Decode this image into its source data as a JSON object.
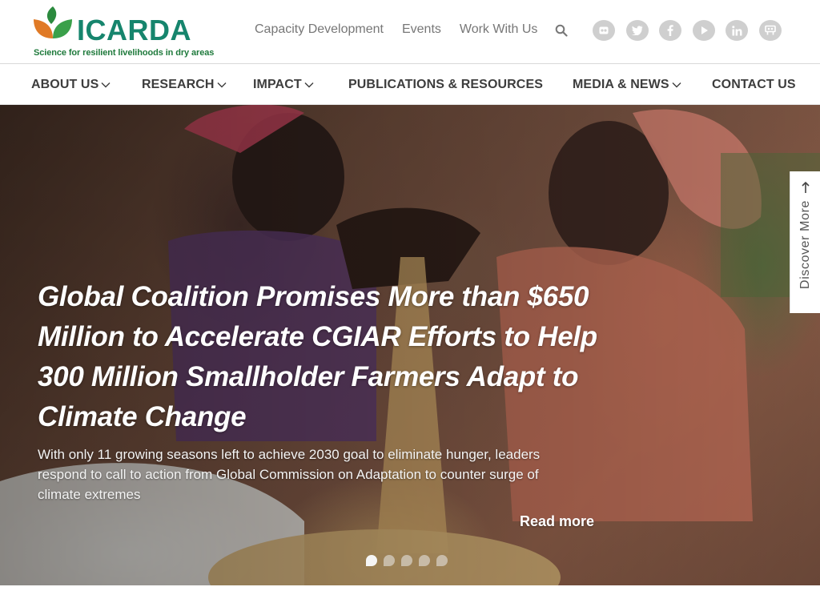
{
  "brand": {
    "name": "ICARDA",
    "tagline": "Science for resilient livelihoods in dry areas",
    "colors": {
      "green": "#16856d",
      "leaf_orange": "#e07a26",
      "leaf_green": "#2b8a3e"
    }
  },
  "top_links": [
    {
      "label": "Capacity Development"
    },
    {
      "label": "Events"
    },
    {
      "label": "Work With Us"
    }
  ],
  "search": {
    "icon": "search-icon"
  },
  "social": [
    {
      "icon": "flickr-icon"
    },
    {
      "icon": "twitter-icon"
    },
    {
      "icon": "facebook-icon"
    },
    {
      "icon": "youtube-icon"
    },
    {
      "icon": "linkedin-icon"
    },
    {
      "icon": "slideshare-icon"
    }
  ],
  "main_nav": [
    {
      "label": "ABOUT US",
      "has_dropdown": true
    },
    {
      "label": "RESEARCH",
      "has_dropdown": true
    },
    {
      "label": "IMPACT",
      "has_dropdown": true
    },
    {
      "label": "PUBLICATIONS & RESOURCES",
      "has_dropdown": false
    },
    {
      "label": "MEDIA & NEWS",
      "has_dropdown": true
    },
    {
      "label": "CONTACT US",
      "has_dropdown": false
    }
  ],
  "hero": {
    "title": "Global Coalition Promises More than $650 Million to Accelerate CGIAR Efforts to Help 300 Million Smallholder Farmers Adapt to Climate Change",
    "subtitle": "With only 11 growing seasons left to achieve 2030 goal to eliminate hunger, leaders respond to call to action from Global Commission on Adaptation to counter surge of climate extremes",
    "read_more": "Read more",
    "slide_count": 5,
    "active_slide": 1
  },
  "discover": {
    "label": "Discover More"
  }
}
